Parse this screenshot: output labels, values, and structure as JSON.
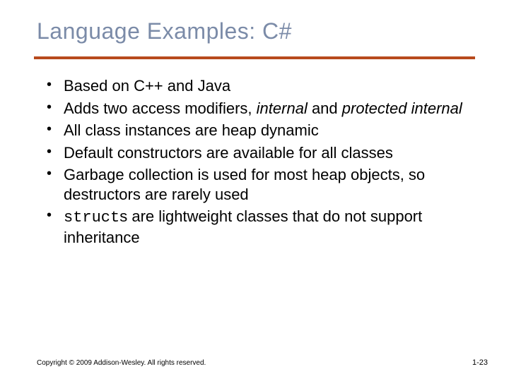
{
  "title": "Language Examples: C#",
  "bullets": {
    "b1": "Based on C++ and Java",
    "b2_a": "Adds two access modifiers, ",
    "b2_em1": "internal",
    "b2_b": " and ",
    "b2_em2": "protected internal",
    "b3": "All class instances are heap dynamic",
    "b4": "Default constructors are available for all classes",
    "b5": "Garbage collection is used for most heap objects, so destructors are rarely used",
    "b6_code": "struct",
    "b6_rest": "s are lightweight classes that do not support inheritance"
  },
  "footer": {
    "copyright": "Copyright © 2009 Addison-Wesley. All rights reserved.",
    "page": "1-23"
  }
}
